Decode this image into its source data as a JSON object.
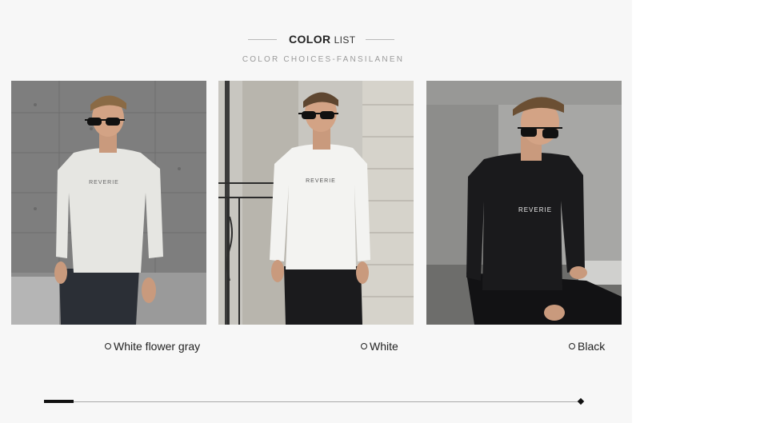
{
  "header": {
    "title_bold": "COLOR",
    "title_light": "LIST",
    "subtitle": "COLOR CHOICES-FANSILANEN"
  },
  "products": [
    {
      "color_name": "White flower gray",
      "shirt_print": "REVERIE",
      "photo_icon": "model-photo-white-flower-gray"
    },
    {
      "color_name": "White",
      "shirt_print": "REVERIE",
      "photo_icon": "model-photo-white"
    },
    {
      "color_name": "Black",
      "shirt_print": "REVERIE",
      "photo_icon": "model-photo-black"
    }
  ],
  "carousel": {
    "scroll_position": 0.05
  },
  "colors": {
    "panel_bg": "#f7f7f7",
    "text_dark": "#222222",
    "subtitle_gray": "#9a9a9a",
    "track": "#a8a8a8",
    "thumb": "#111111"
  }
}
